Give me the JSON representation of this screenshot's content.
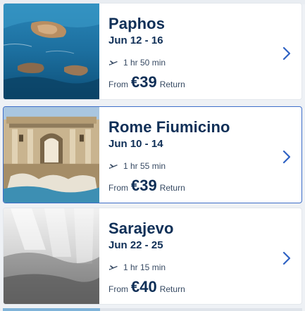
{
  "results": [
    {
      "city": "Paphos",
      "dates": "Jun 12 - 16",
      "duration": "1 hr 50 min",
      "from_label": "From",
      "price": "€39",
      "trip_type": "Return",
      "image": "paphos-coast-photo"
    },
    {
      "city": "Rome Fiumicino",
      "dates": "Jun 10 - 14",
      "duration": "1 hr 55 min",
      "from_label": "From",
      "price": "€39",
      "trip_type": "Return",
      "image": "trevi-fountain-photo",
      "selected": true
    },
    {
      "city": "Sarajevo",
      "dates": "Jun 22 - 25",
      "duration": "1 hr 15 min",
      "from_label": "From",
      "price": "€40",
      "trip_type": "Return",
      "image": "placeholder-photo"
    }
  ],
  "colors": {
    "text_primary": "#0f2f57",
    "text_secondary": "#374a63",
    "chevron": "#2f62c3",
    "selected_border": "#3e6ec9"
  },
  "icons": {
    "duration": "plane-icon",
    "navigate": "chevron-right-icon"
  }
}
